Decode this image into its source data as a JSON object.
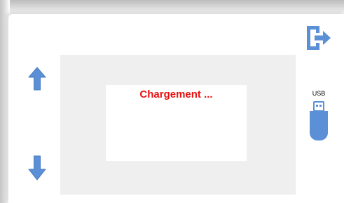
{
  "loading": {
    "text": "Chargement ..."
  },
  "usb": {
    "label": "USB"
  },
  "icons": {
    "scroll_up": "arrow-up-icon",
    "scroll_down": "arrow-down-icon",
    "logout": "logout-icon",
    "usb": "usb-drive-icon"
  },
  "colors": {
    "icon_blue": "#5b8fd6",
    "loading_red": "#e81010",
    "area_gray": "#efefef"
  }
}
